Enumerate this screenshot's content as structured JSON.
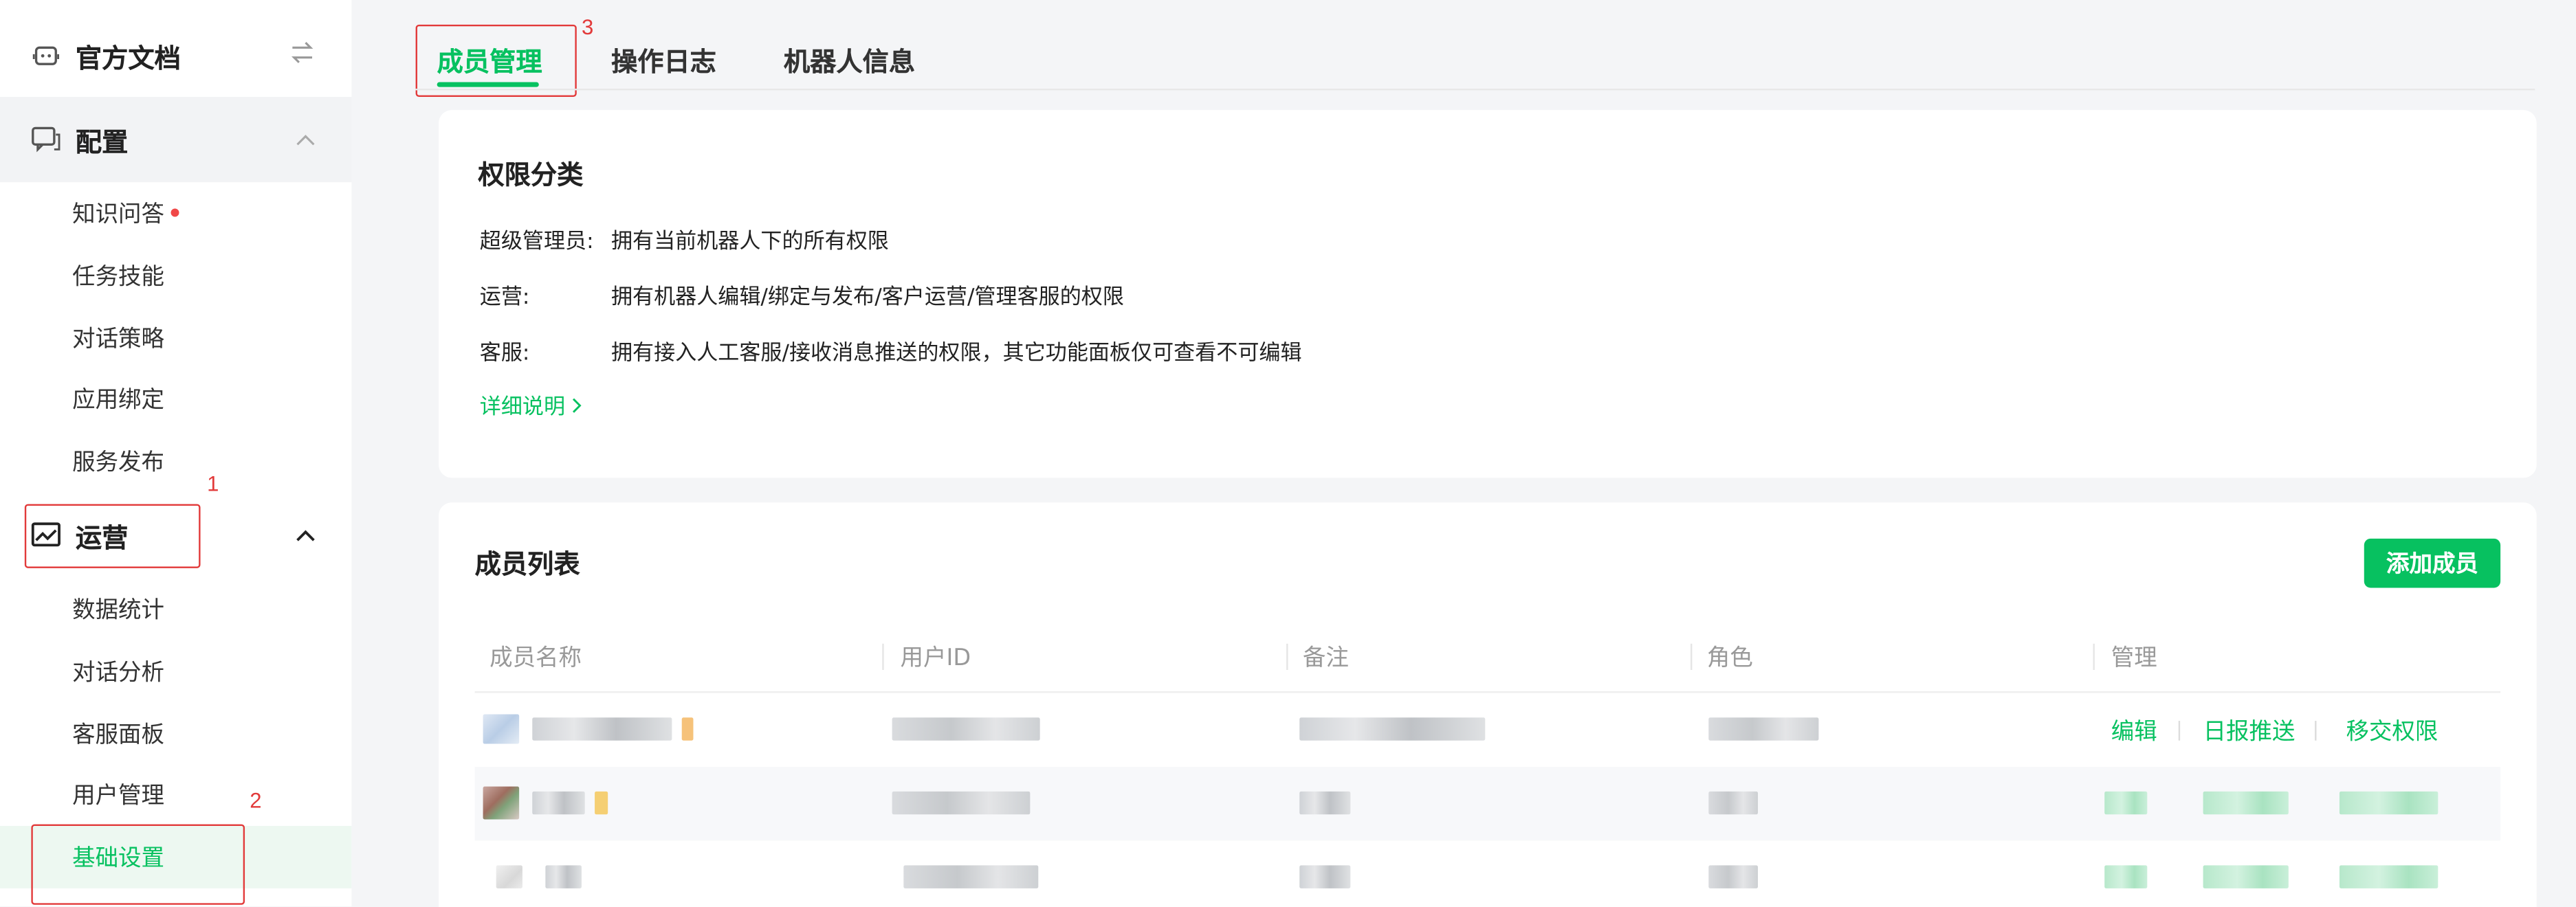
{
  "sidebar": {
    "docs": {
      "label": "官方文档",
      "icon": "robot-icon",
      "action_icon": "switch-arrows-icon"
    },
    "config": {
      "label": "配置",
      "icon": "chat-bubble-icon"
    },
    "config_items": [
      "知识问答",
      "任务技能",
      "对话策略",
      "应用绑定",
      "服务发布"
    ],
    "ops": {
      "label": "运营",
      "icon": "chart-icon"
    },
    "ops_items": [
      "数据统计",
      "对话分析",
      "客服面板",
      "用户管理",
      "基础设置"
    ],
    "active_item": "基础设置"
  },
  "annotations": [
    "1",
    "2",
    "3"
  ],
  "tabs": [
    "成员管理",
    "操作日志",
    "机器人信息"
  ],
  "active_tab": "成员管理",
  "permissions": {
    "title": "权限分类",
    "rows": [
      {
        "key": "超级管理员:",
        "value": "拥有当前机器人下的所有权限"
      },
      {
        "key": "运营:",
        "value": "拥有机器人编辑/绑定与发布/客户运营/管理客服的权限"
      },
      {
        "key": "客服:",
        "value": "拥有接入人工客服/接收消息推送的权限，其它功能面板仅可查看不可编辑"
      }
    ],
    "detail_link": "详细说明"
  },
  "members": {
    "title": "成员列表",
    "add_button": "添加成员",
    "columns": [
      "成员名称",
      "用户ID",
      "备注",
      "角色",
      "管理"
    ],
    "actions": [
      "编辑",
      "日报推送",
      "移交权限"
    ]
  },
  "colors": {
    "accent": "#07c160",
    "annotation": "#e23a3a"
  }
}
